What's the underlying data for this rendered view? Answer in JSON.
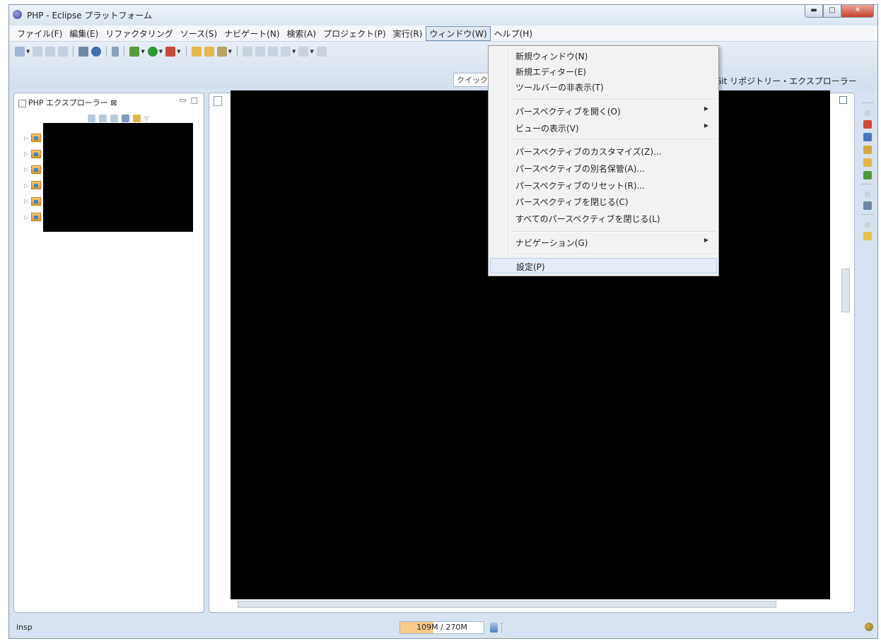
{
  "window": {
    "title": "PHP - Eclipse プラットフォーム"
  },
  "menubar": {
    "items": [
      {
        "label": "ファイル(F)"
      },
      {
        "label": "編集(E)"
      },
      {
        "label": "リファクタリング"
      },
      {
        "label": "ソース(S)"
      },
      {
        "label": "ナビゲート(N)"
      },
      {
        "label": "検索(A)"
      },
      {
        "label": "プロジェクト(P)"
      },
      {
        "label": "実行(R)"
      },
      {
        "label": "ウィンドウ(W)"
      },
      {
        "label": "ヘルプ(H)"
      }
    ],
    "active_index": 8
  },
  "toolbar": {
    "quick_access_placeholder": "クイック",
    "perspective_label": "Git リポジトリー・エクスプローラー"
  },
  "explorer": {
    "tab_label": "PHP エクスプローラー ⊠",
    "project_count": 6
  },
  "window_menu": {
    "items": [
      {
        "label": "新規ウィンドウ(N)",
        "submenu": false
      },
      {
        "label": "新規エディター(E)",
        "submenu": false
      },
      {
        "label": "ツールバーの非表示(T)",
        "submenu": false
      },
      {
        "label": "パースペクティブを開く(O)",
        "submenu": true
      },
      {
        "label": "ビューの表示(V)",
        "submenu": true
      },
      {
        "label": "パースペクティブのカスタマイズ(Z)...",
        "submenu": false
      },
      {
        "label": "パースペクティブの別名保管(A)...",
        "submenu": false
      },
      {
        "label": "パースペクティブのリセット(R)...",
        "submenu": false
      },
      {
        "label": "パースペクティブを閉じる(C)",
        "submenu": false
      },
      {
        "label": "すべてのパースペクティブを閉じる(L)",
        "submenu": false
      },
      {
        "label": "ナビゲーション(G)",
        "submenu": true
      },
      {
        "label": "設定(P)",
        "submenu": false
      }
    ],
    "highlighted_index": 11
  },
  "status": {
    "mode": "insp",
    "heap_text": "109M / 270M",
    "heap_used_fraction": 0.4
  }
}
